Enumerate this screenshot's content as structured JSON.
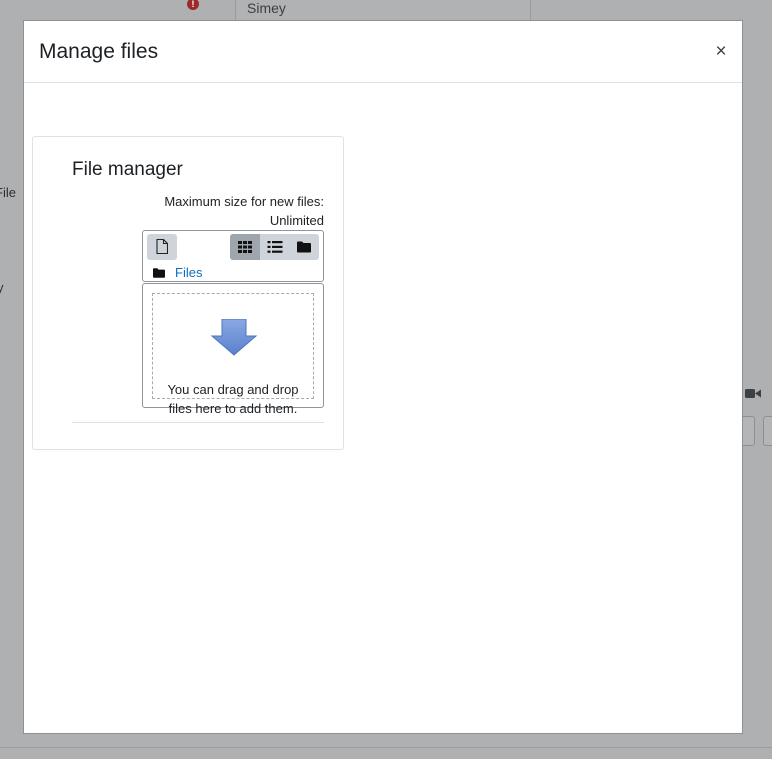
{
  "background": {
    "field_value": "Simey",
    "side_label_1": "File",
    "side_label_2": "y"
  },
  "modal": {
    "title": "Manage files",
    "close_label": "×"
  },
  "file_manager": {
    "heading": "File manager",
    "max_size_label": "Maximum size for new files:",
    "max_size_value": "Unlimited",
    "toolbar": {
      "add_file_icon": "file-icon",
      "view_icons": [
        "grid-icon",
        "list-icon",
        "folder-icon"
      ]
    },
    "path_label": "Files",
    "drop_text_line1": "You can drag and drop",
    "drop_text_line2": "files here to add them."
  },
  "colors": {
    "accent_link": "#0f6cbf",
    "drop_arrow": "#6d93d6"
  }
}
